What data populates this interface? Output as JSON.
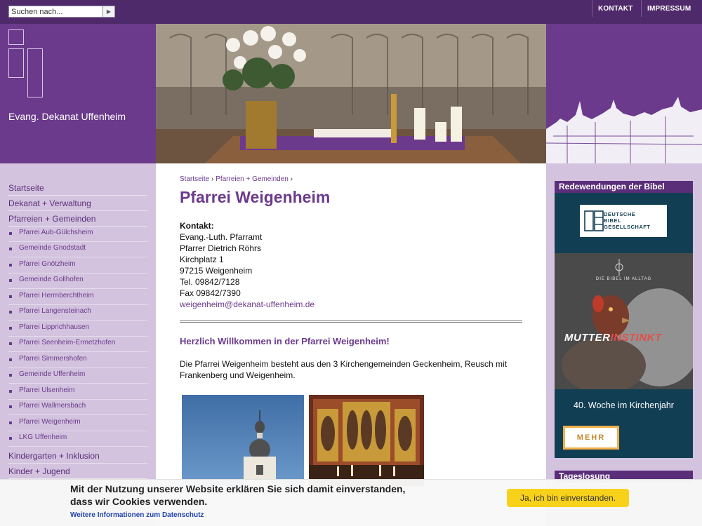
{
  "search": {
    "placeholder": "Suchen nach..."
  },
  "toplinks": [
    "KONTAKT",
    "IMPRESSUM"
  ],
  "site": {
    "name": "Evang. Dekanat Uffenheim"
  },
  "nav": {
    "top": [
      "Startseite",
      "Dekanat + Verwaltung",
      "Pfarreien + Gemeinden"
    ],
    "sub": [
      "Pfarrei Aub-Gülchsheim",
      "Gemeinde Gnodstadt",
      "Pfarrei Gnötzheim",
      "Gemeinde Gollhofen",
      "Pfarrei Herrnberchtheim",
      "Pfarrei Langensteinach",
      "Pfarrei Lipprichhausen",
      "Pfarrei Seenheim-Ermetzhofen",
      "Pfarrei Simmershofen",
      "Gemeinde Uffenheim",
      "Pfarrei Ulsenheim",
      "Pfarrei Wallmersbach",
      "Pfarrei Weigenheim",
      "LKG Uffenheim"
    ],
    "bottom": [
      "Kindergarten + Inklusion",
      "Kinder + Jugend"
    ]
  },
  "breadcrumb": {
    "home": "Startseite",
    "sep": "›",
    "section": "Pfarreien + Gemeinden"
  },
  "page": {
    "title": "Pfarrei Weigenheim"
  },
  "contact": {
    "label": "Kontakt:",
    "lines": [
      "Evang.-Luth. Pfarramt",
      "Pfarrer Dietrich Röhrs",
      "Kirchplatz 1",
      "97215 Weigenheim",
      "Tel. 09842/7128",
      "Fax 09842/7390"
    ],
    "email": "weigenheim@dekanat-uffenheim.de"
  },
  "welcome": "Herzlich Willkommen in der Pfarrei Weigenheim!",
  "intro": "Die Pfarrei Weigenheim besteht aus den 3 Kirchengemeinden Geckenheim, Reusch mit Frankenberg und Weigenheim.",
  "sidebar": {
    "bible_heading": "Redewendungen der Bibel",
    "dbg_logo_lines": [
      "DEUTSCHE",
      "BIBEL",
      "GESELLSCHAFT"
    ],
    "banner_top": "DIE BIBEL IM ALLTAG",
    "banner_word_a": "MUTTER",
    "banner_word_b": "INSTINKT",
    "week": "40. Woche im Kirchenjahr",
    "more": "MEHR",
    "losung_heading": "Tageslosung"
  },
  "cookie": {
    "text": "Mit der Nutzung unserer Website erklären Sie sich damit einverstanden, dass wir Cookies verwenden.",
    "link": "Weitere Informationen zum Datenschutz",
    "accept": "Ja, ich bin einverstanden."
  }
}
